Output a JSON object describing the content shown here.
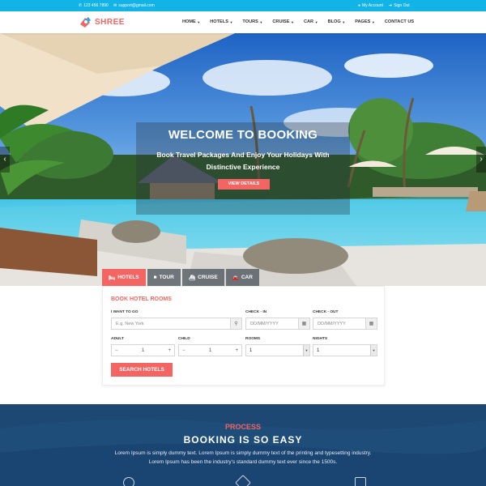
{
  "topbar": {
    "phone": "123 456 7890",
    "email": "support@gmail.com",
    "account": "My Account",
    "signout": "Sign Out",
    "color": "#12b3e6"
  },
  "brand": {
    "name": "SHREE",
    "color": "#f26563"
  },
  "nav": {
    "items": [
      {
        "label": "HOME",
        "dropdown": true
      },
      {
        "label": "HOTELS",
        "dropdown": true
      },
      {
        "label": "TOURS",
        "dropdown": true
      },
      {
        "label": "CRUISE",
        "dropdown": true
      },
      {
        "label": "CAR",
        "dropdown": true
      },
      {
        "label": "BLOG",
        "dropdown": true
      },
      {
        "label": "PAGES",
        "dropdown": true
      },
      {
        "label": "CONTACT US",
        "dropdown": false
      }
    ]
  },
  "hero": {
    "title": "WELCOME TO BOOKING",
    "subtitle_line1": "Book Travel Packages And Enjoy Your Holidays With",
    "subtitle_line2": "Distinctive Experience",
    "button": "VIEW DETAILS",
    "prev_icon": "chevron-left-icon",
    "next_icon": "chevron-right-icon"
  },
  "tabs": [
    {
      "label": "HOTELS",
      "icon": "bed-icon",
      "active": true
    },
    {
      "label": "TOUR",
      "icon": "suitcase-icon",
      "active": false
    },
    {
      "label": "CRUISE",
      "icon": "ship-icon",
      "active": false
    },
    {
      "label": "CAR",
      "icon": "car-icon",
      "active": false
    }
  ],
  "form": {
    "title": "BOOK HOTEL ROOMS",
    "go_label": "I WANT TO GO",
    "go_placeholder": "E.g. New York",
    "checkin_label": "CHECK - IN",
    "checkin_placeholder": "DD/MM/YYYY",
    "checkout_label": "CHECK - OUT",
    "checkout_placeholder": "DD/MM/YYYY",
    "adult_label": "ADULT",
    "adult_value": "1",
    "child_label": "CHILD",
    "child_value": "1",
    "rooms_label": "ROOMS",
    "rooms_value": "1",
    "nights_label": "NIGHTS",
    "nights_value": "1",
    "minus": "−",
    "plus": "+",
    "search_button": "SEARCH HOTELS"
  },
  "process": {
    "label": "PROCESS",
    "title": "BOOKING IS SO EASY",
    "text_line1": "Lorem Ipsum is simply dummy text. Lorem Ipsum is simply dummy text of the printing and typesetting industry.",
    "text_line2": "Lorem Ipsum has been the industry's standard dummy text ever since the 1500s."
  }
}
